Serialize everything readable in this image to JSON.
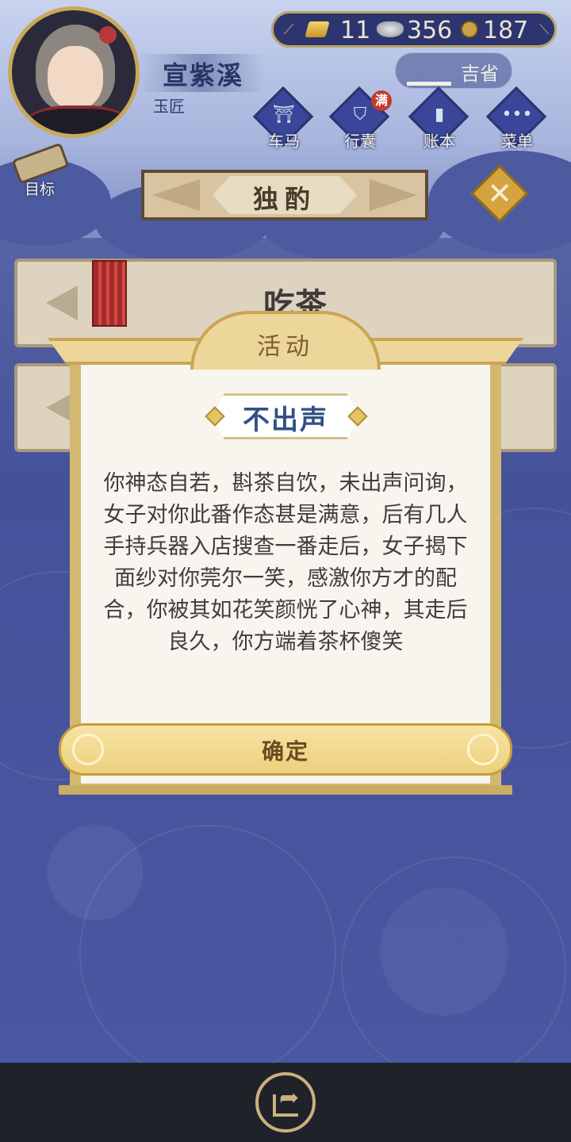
{
  "player": {
    "name": "宣紫溪",
    "title": "玉匠"
  },
  "currency": {
    "gold": "11",
    "silver": "356",
    "coins": "187"
  },
  "status_chip": {
    "label": "吉省",
    "icon": "iron-icon"
  },
  "nav": [
    {
      "label": "车马",
      "icon": "carriage-icon"
    },
    {
      "label": "行囊",
      "icon": "bag-icon",
      "badge": "满"
    },
    {
      "label": "账本",
      "icon": "ledger-icon"
    },
    {
      "label": "菜单",
      "icon": "menu-dots-icon"
    }
  ],
  "goal": {
    "label": "目标"
  },
  "location": {
    "title": "独酌"
  },
  "options": [
    {
      "label": "吃茶"
    }
  ],
  "dialog": {
    "header": "活动",
    "event_title": "不出声",
    "body": "你神态自若，斟茶自饮，未出声问询，女子对你此番作态甚是满意，后有几人手持兵器入店搜查一番走后，女子揭下面纱对你莞尔一笑，感激你方才的配合，你被其如花笑颜恍了心神，其走后良久，你方端着茶杯傻笑",
    "confirm_label": "确定"
  },
  "colors": {
    "dialog_gold": "#d3b96f",
    "title_blue": "#344f86",
    "background": "#4a57a1"
  }
}
